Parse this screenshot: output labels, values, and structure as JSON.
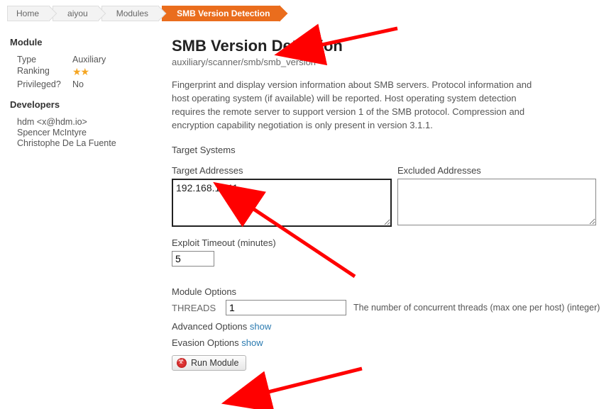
{
  "breadcrumb": {
    "items": [
      "Home",
      "aiyou",
      "Modules",
      "SMB Version Detection"
    ],
    "activeIndex": 3
  },
  "sidebar": {
    "module_heading": "Module",
    "type_label": "Type",
    "type_value": "Auxiliary",
    "ranking_label": "Ranking",
    "ranking_value": "★★",
    "privileged_label": "Privileged?",
    "privileged_value": "No",
    "developers_heading": "Developers",
    "developers": [
      "hdm <x@hdm.io>",
      "Spencer McIntyre",
      "Christophe De La Fuente"
    ]
  },
  "main": {
    "title": "SMB Version Detection",
    "path": "auxiliary/scanner/smb/smb_version",
    "description": "Fingerprint and display version information about SMB servers. Protocol information and host operating system (if available) will be reported. Host operating system detection requires the remote server to support version 1 of the SMB protocol. Compression and encryption capability negotiation is only present in version 3.1.1.",
    "target_systems_heading": "Target Systems",
    "target_addresses_label": "Target Addresses",
    "target_addresses_value": "192.168.1.111",
    "excluded_addresses_label": "Excluded Addresses",
    "excluded_addresses_value": "",
    "exploit_timeout_label": "Exploit Timeout (minutes)",
    "exploit_timeout_value": "5",
    "module_options_heading": "Module Options",
    "threads_label": "THREADS",
    "threads_value": "1",
    "threads_help": "The number of concurrent threads (max one per host) (integer)",
    "advanced_options_label": "Advanced Options",
    "evasion_options_label": "Evasion Options",
    "show_link": "show",
    "run_button_label": "Run Module"
  }
}
